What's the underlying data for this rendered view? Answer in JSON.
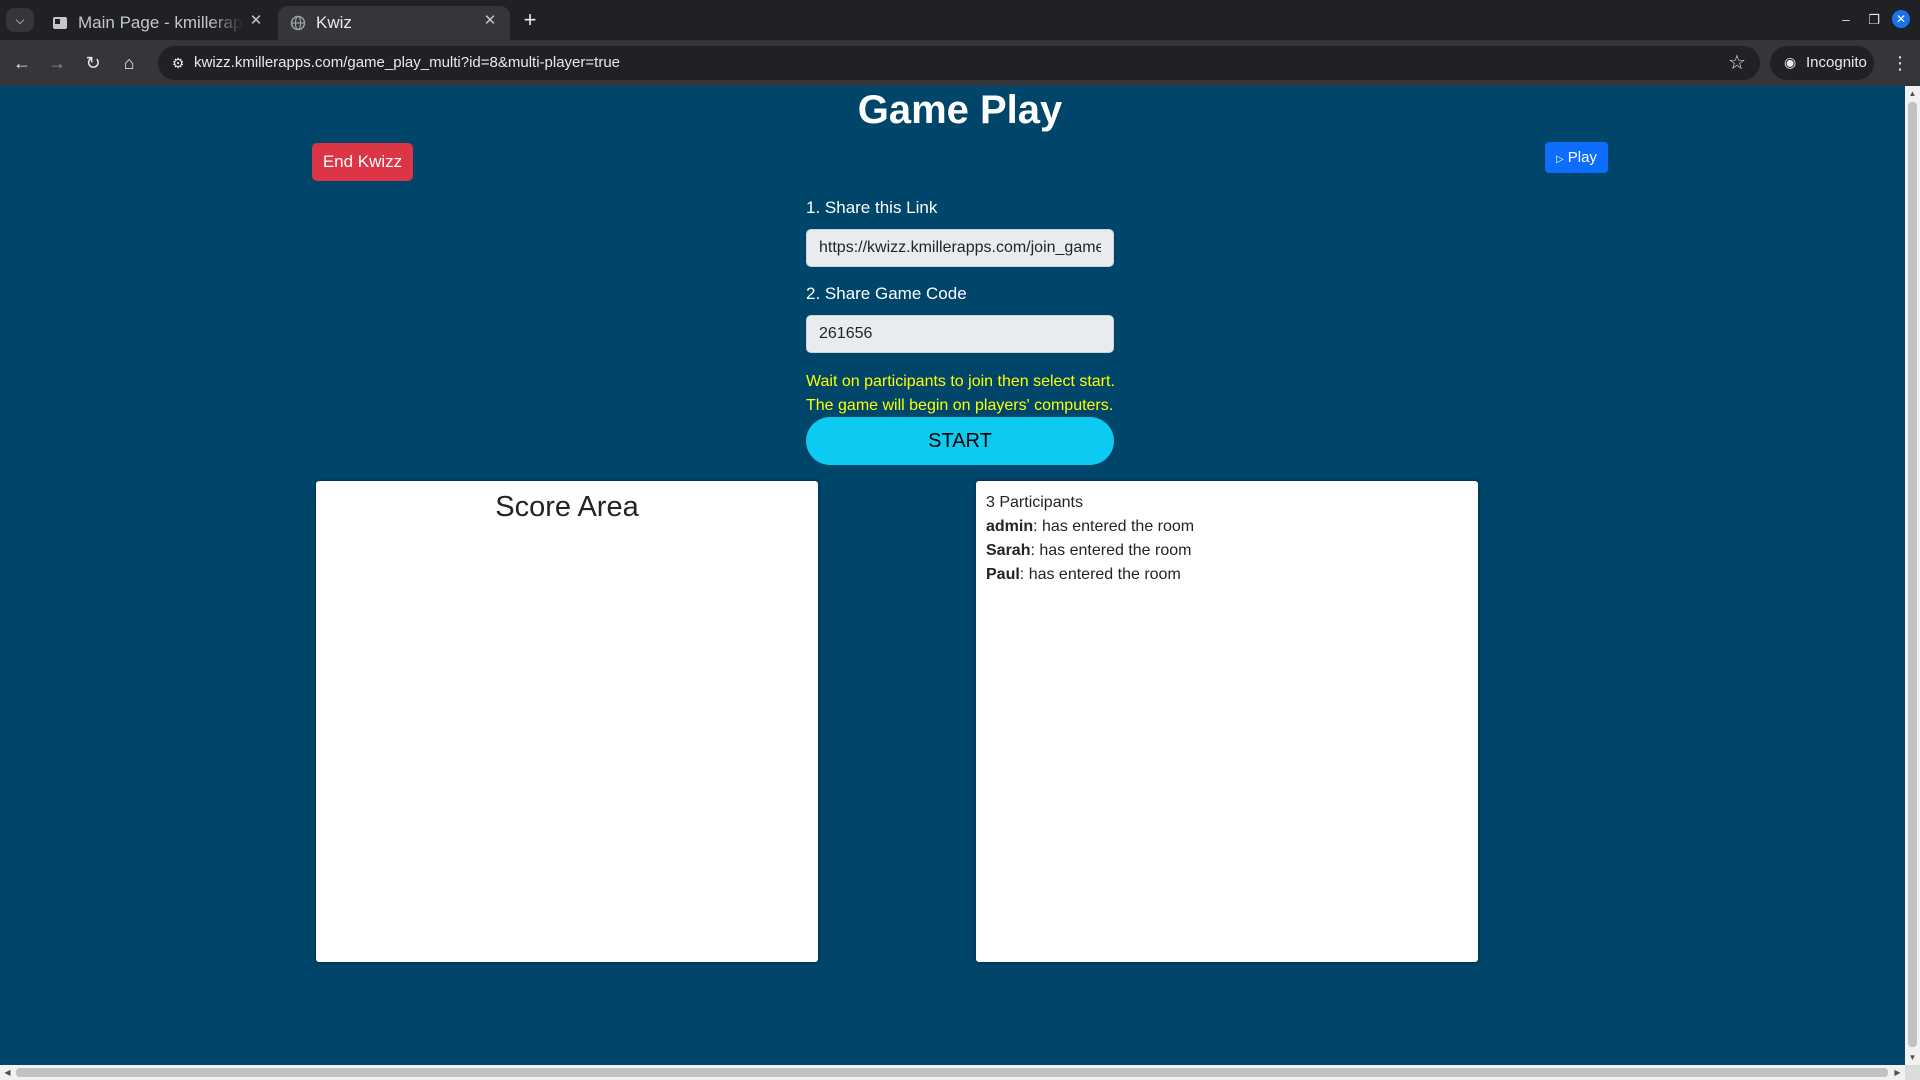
{
  "browser": {
    "tabs": [
      {
        "title": "Main Page - kmillerapps",
        "active": false
      },
      {
        "title": "Kwiz",
        "active": true
      }
    ],
    "url": "kwizz.kmillerapps.com/game_play_multi?id=8&multi-player=true",
    "incognito_label": "Incognito"
  },
  "page": {
    "title": "Game Play",
    "end_button": "End Kwizz",
    "play_button": "Play",
    "share_link_label": "1. Share this Link",
    "share_link_value": "https://kwizz.kmillerapps.com/join_game",
    "share_code_label": "2. Share Game Code",
    "share_code_value": "261656",
    "wait_line1": "Wait on participants to join then select start.",
    "wait_line2": "The game will begin on players' computers.",
    "start_button": "START",
    "score_title": "Score Area",
    "participants_count": "3 Participants",
    "participants": [
      {
        "name": "admin",
        "message": ": has entered the room"
      },
      {
        "name": "Sarah",
        "message": ": has entered the room"
      },
      {
        "name": "Paul",
        "message": ": has entered the room"
      }
    ]
  },
  "colors": {
    "page_bg": "#00456a",
    "end_button": "#dc3545",
    "play_button": "#0d6efd",
    "start_button": "#0dcaf0",
    "wait_text": "#ffff00"
  },
  "icons": [
    "tab-search-icon",
    "page-favicon-icon",
    "globe-icon",
    "close-icon",
    "new-tab-icon",
    "back-icon",
    "forward-icon",
    "reload-icon",
    "home-icon",
    "site-info-icon",
    "bookmark-star-icon",
    "incognito-icon",
    "more-menu-icon",
    "play-icon"
  ]
}
